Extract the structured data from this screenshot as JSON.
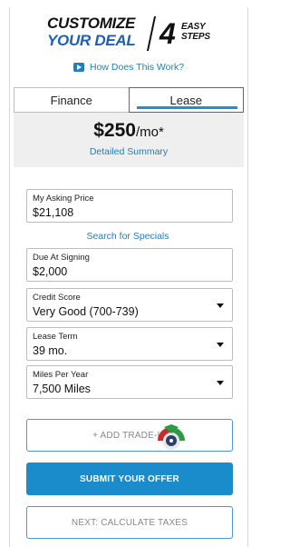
{
  "header": {
    "line1": "CUSTOMIZE",
    "line2": "YOUR DEAL",
    "steps_number": "4",
    "steps_word1": "EASY",
    "steps_word2": "STEPS"
  },
  "how_link": {
    "label": "How Does This Work?",
    "icon": "play-icon"
  },
  "tabs": [
    {
      "label": "Finance",
      "selected": false
    },
    {
      "label": "Lease",
      "selected": true
    }
  ],
  "summary": {
    "price": "$250",
    "unit": "/mo*",
    "detail_link": "Detailed Summary"
  },
  "fields": {
    "asking_price": {
      "label": "My Asking Price",
      "value": "$21,108"
    },
    "due_at_signing": {
      "label": "Due At Signing",
      "value": "$2,000"
    },
    "credit_score": {
      "label": "Credit Score",
      "value": "Very Good (700-739)"
    },
    "lease_term": {
      "label": "Lease Term",
      "value": "39 mo."
    },
    "miles_per_year": {
      "label": "Miles Per Year",
      "value": "7,500 Miles"
    }
  },
  "specials_link": "Search for Specials",
  "buttons": {
    "trade_in": "+ ADD TRADE-IN",
    "submit": "SUBMIT YOUR OFFER",
    "taxes": "NEXT: CALCULATE TAXES"
  },
  "colors": {
    "accent_blue": "#1a8ccc",
    "link_blue": "#1f7fbf",
    "brand_blue": "#1d5fb8",
    "gauge_green": "#2f9a46",
    "gauge_red": "#c42d2d"
  }
}
